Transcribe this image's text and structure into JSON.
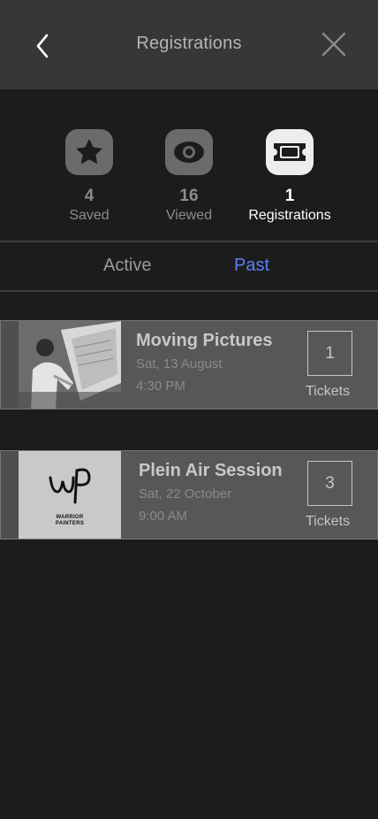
{
  "header": {
    "title": "Registrations"
  },
  "stats": [
    {
      "count": "4",
      "label": "Saved",
      "icon": "star-icon"
    },
    {
      "count": "16",
      "label": "Viewed",
      "icon": "eye-icon"
    },
    {
      "count": "1",
      "label": "Registrations",
      "icon": "ticket-icon"
    }
  ],
  "tabs": {
    "active": "Active",
    "past": "Past"
  },
  "events": [
    {
      "name": "Moving Pictures",
      "date": "Sat, 13 August",
      "time": "4:30 PM",
      "tickets_count": "1",
      "tickets_label": "Tickets"
    },
    {
      "name": "Plein Air Session",
      "date": "Sat, 22 October",
      "time": "9:00 AM",
      "tickets_count": "3",
      "tickets_label": "Tickets",
      "logo_text": "WARRIOR PAINTERS"
    }
  ],
  "colors": {
    "accent": "#5b7ef5",
    "background": "#1c1c1c",
    "header": "#373737"
  }
}
